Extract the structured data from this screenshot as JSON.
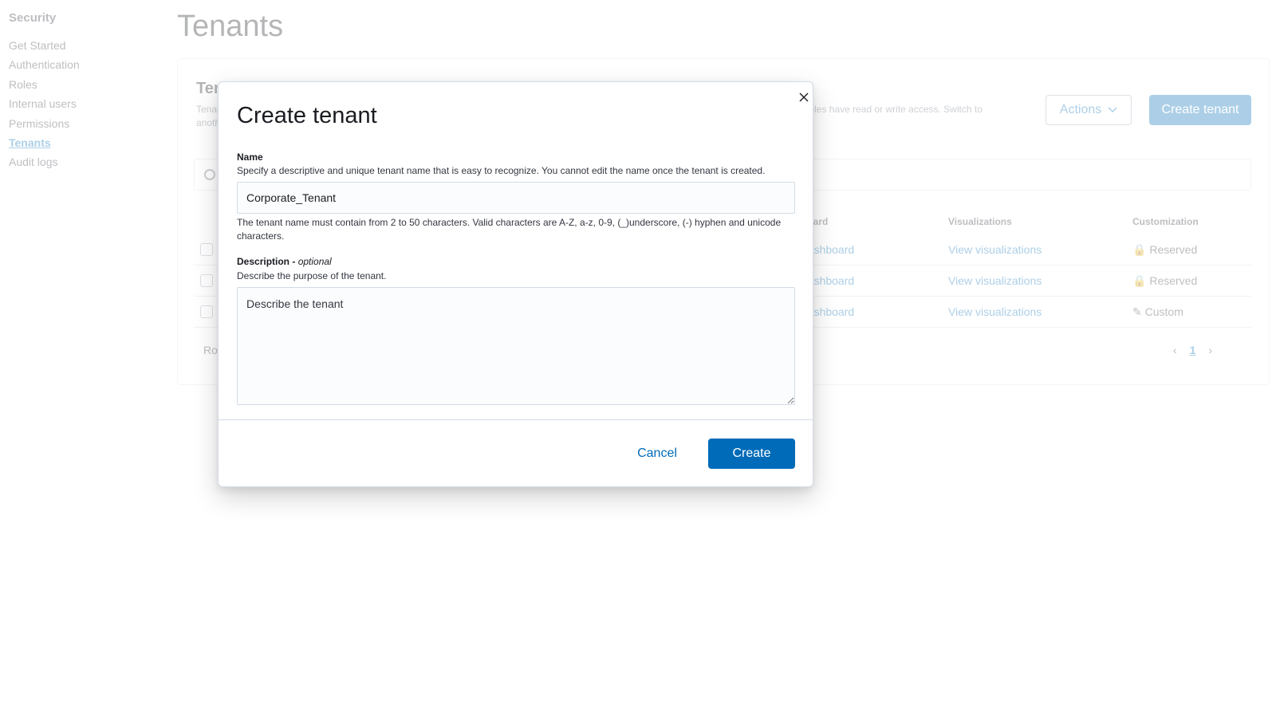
{
  "sidebar": {
    "title": "Security",
    "items": [
      {
        "label": "Get Started"
      },
      {
        "label": "Authentication"
      },
      {
        "label": "Roles"
      },
      {
        "label": "Internal users"
      },
      {
        "label": "Permissions"
      },
      {
        "label": "Tenants",
        "active": true
      },
      {
        "label": "Audit logs"
      }
    ]
  },
  "page": {
    "title": "Tenants"
  },
  "panel": {
    "title": "Tenants",
    "description_left": "Tenants are useful for safely sharing your work with other Kibana users. You can control which roles have access to a tenant and whether those roles have read or write access. Switch to another tenant anytime from your",
    "description_right": "ork with other Kibana users. You can control now. Switch to another tenant anytime from",
    "actions_label": "Actions",
    "create_tenant_label": "Create tenant",
    "columns": {
      "dashboard": "board",
      "visualizations": "Visualizations",
      "customization": "Customization"
    },
    "rows": [
      {
        "dashboard": "dashboard",
        "visualizations": "View visualizations",
        "customization": "Reserved",
        "icon": "lock-icon"
      },
      {
        "dashboard": "dashboard",
        "visualizations": "View visualizations",
        "customization": "Reserved",
        "icon": "lock-icon"
      },
      {
        "dashboard": "dashboard",
        "visualizations": "View visualizations",
        "customization": "Custom",
        "icon": "pencil-icon"
      }
    ],
    "rows_per_page_label": "Ro",
    "current_page": "1"
  },
  "modal": {
    "title": "Create tenant",
    "name": {
      "label": "Name",
      "help_top": "Specify a descriptive and unique tenant name that is easy to recognize. You cannot edit the name once the tenant is created.",
      "value": "Corporate_Tenant",
      "help_bottom": "The tenant name must contain from 2 to 50 characters. Valid characters are A-Z, a-z, 0-9, (_)underscore, (-) hyphen and unicode characters."
    },
    "description": {
      "label": "Description",
      "optional": "optional",
      "separator": " - ",
      "help": "Describe the purpose of the tenant.",
      "placeholder": "Describe the tenant",
      "value": ""
    },
    "cancel_label": "Cancel",
    "create_label": "Create"
  },
  "colors": {
    "primary": "#006bb8",
    "text": "#343741",
    "border": "#d3dae6"
  }
}
